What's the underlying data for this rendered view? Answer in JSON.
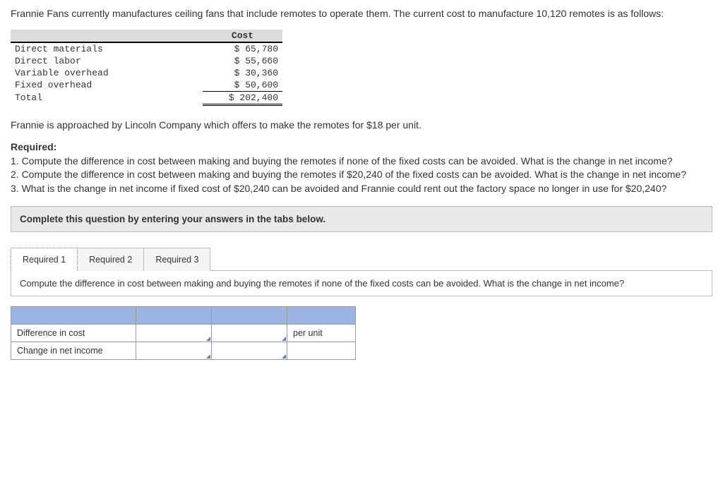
{
  "intro": "Frannie Fans currently manufactures ceiling fans that include remotes to operate them. The current cost to manufacture 10,120 remotes is as follows:",
  "cost_table": {
    "header_cost": "Cost",
    "rows": [
      {
        "label": "Direct materials",
        "amount": "65,780"
      },
      {
        "label": "Direct labor",
        "amount": "55,660"
      },
      {
        "label": "Variable overhead",
        "amount": "30,360"
      },
      {
        "label": "Fixed overhead",
        "amount": "50,600"
      }
    ],
    "total_label": "Total",
    "total_amount": "202,400"
  },
  "approach": "Frannie is approached by Lincoln Company which offers to make the remotes for $18 per unit.",
  "required": {
    "heading": "Required:",
    "item1": "1. Compute the difference in cost between making and buying the remotes if none of the fixed costs can be avoided. What is the change in net income?",
    "item2": "2. Compute the difference in cost between making and buying the remotes if $20,240 of the fixed costs can be avoided. What is the change in net income?",
    "item3": "3. What is the change in net income if fixed cost of $20,240 can be avoided and Frannie could rent out the factory space no longer in use for $20,240?"
  },
  "instruction": "Complete this question by entering your answers in the tabs below.",
  "tabs": {
    "t1": "Required 1",
    "t2": "Required 2",
    "t3": "Required 3"
  },
  "panel1": {
    "prompt": "Compute the difference in cost between making and buying the remotes if none of the fixed costs can be avoided. What is the change in net income?",
    "row1": "Difference in cost",
    "row2": "Change in net income",
    "per_unit": "per unit"
  }
}
